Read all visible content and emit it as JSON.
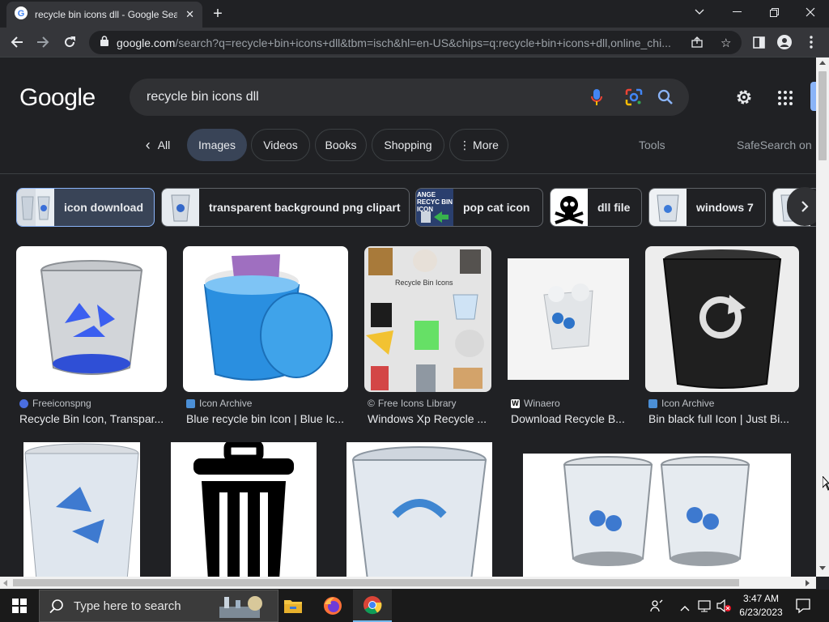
{
  "browser": {
    "tab_title": "recycle bin icons dll - Google Sea",
    "url_host": "google.com",
    "url_rest": "/search?q=recycle+bin+icons+dll&tbm=isch&hl=en-US&chips=q:recycle+bin+icons+dll,online_chi..."
  },
  "google": {
    "logo": "Google",
    "query": "recycle bin icons dll",
    "tabs": [
      {
        "label": "All",
        "prefix": "‹"
      },
      {
        "label": "Images"
      },
      {
        "label": "Videos"
      },
      {
        "label": "Books"
      },
      {
        "label": "Shopping"
      },
      {
        "label": "More",
        "prefix": "⋮"
      }
    ],
    "tools": "Tools",
    "safesearch": "SafeSearch on"
  },
  "chips": [
    {
      "label": "icon download"
    },
    {
      "label": "transparent background png clipart"
    },
    {
      "label": "pop cat icon",
      "thumb_text": "ANGE RECYC BIN ICON"
    },
    {
      "label": "dll file"
    },
    {
      "label": "windows 7"
    }
  ],
  "results": [
    {
      "source": "Freeiconspng",
      "caption": "Recycle Bin Icon, Transpar..."
    },
    {
      "source": "Icon Archive",
      "caption": "Blue recycle bin Icon | Blue Ic..."
    },
    {
      "source": "Free Icons Library",
      "caption": "Windows Xp Recycle ...",
      "img_text": "Recycle Bin Icons"
    },
    {
      "source": "Winaero",
      "caption": "Download Recycle B..."
    },
    {
      "source": "Icon Archive",
      "caption": "Bin black full Icon | Just Bi..."
    }
  ],
  "taskbar": {
    "search_placeholder": "Type here to search",
    "time": "3:47 AM",
    "date": "6/23/2023"
  },
  "colors": {
    "page_bg": "#202124",
    "selected_tab": "#394457",
    "accent_blue": "#8ab4f8"
  }
}
